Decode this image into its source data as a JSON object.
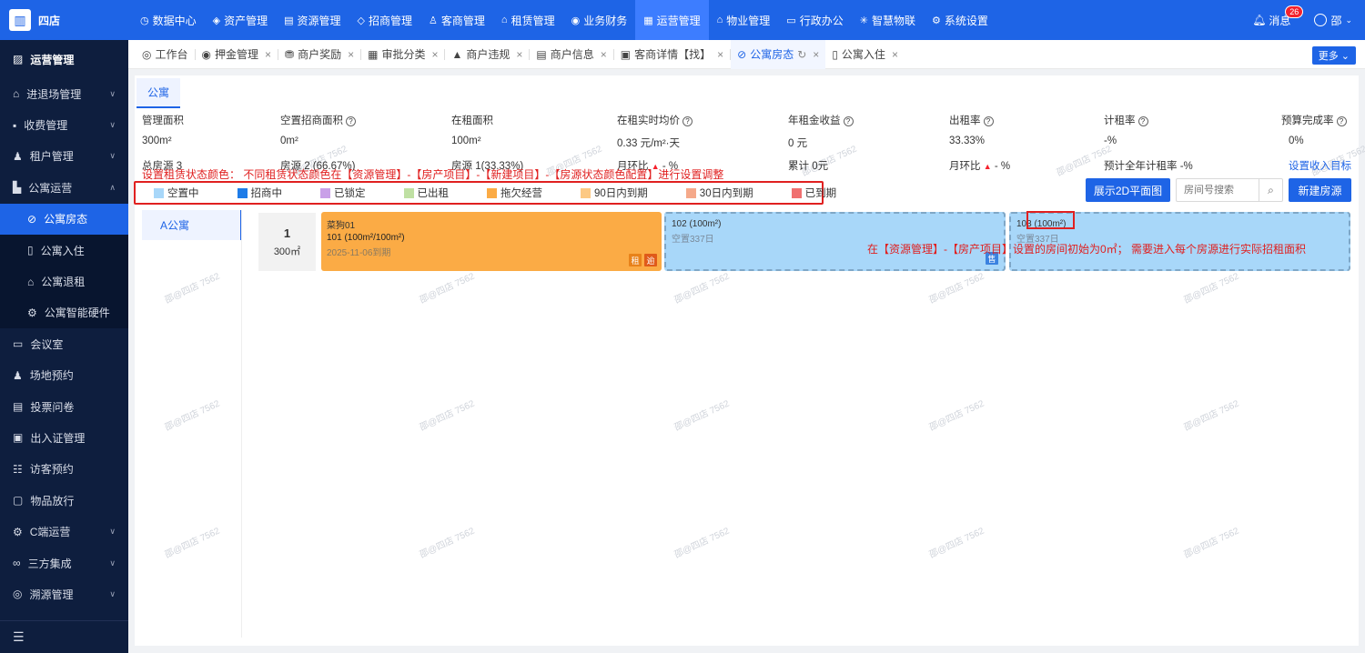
{
  "app": {
    "logo_text": "四店",
    "logo_icon": "building-logo"
  },
  "topnav": [
    {
      "label": "数据中心",
      "icon": "clock-icon"
    },
    {
      "label": "资产管理",
      "icon": "cube-icon"
    },
    {
      "label": "资源管理",
      "icon": "building-icon"
    },
    {
      "label": "招商管理",
      "icon": "tag-icon"
    },
    {
      "label": "客商管理",
      "icon": "users-icon"
    },
    {
      "label": "租赁管理",
      "icon": "house-icon"
    },
    {
      "label": "业务财务",
      "icon": "coin-icon"
    },
    {
      "label": "运营管理",
      "icon": "chart-icon",
      "active": true
    },
    {
      "label": "物业管理",
      "icon": "home-icon"
    },
    {
      "label": "行政办公",
      "icon": "monitor-icon"
    },
    {
      "label": "智慧物联",
      "icon": "iot-icon"
    },
    {
      "label": "系统设置",
      "icon": "gear-icon"
    }
  ],
  "topright": {
    "messages_label": "消息",
    "message_count": "26",
    "user_name": "邵"
  },
  "sidebar": {
    "header": "运营管理",
    "items": [
      {
        "label": "进退场管理",
        "expandable": true
      },
      {
        "label": "收费管理",
        "expandable": true
      },
      {
        "label": "租户管理",
        "expandable": true
      },
      {
        "label": "公寓运营",
        "expandable": true,
        "expanded": true
      },
      {
        "label": "公寓房态",
        "sub": true,
        "active": true
      },
      {
        "label": "公寓入住",
        "sub": true
      },
      {
        "label": "公寓退租",
        "sub": true
      },
      {
        "label": "公寓智能硬件",
        "sub": true
      },
      {
        "label": "会议室"
      },
      {
        "label": "场地预约"
      },
      {
        "label": "投票问卷"
      },
      {
        "label": "出入证管理"
      },
      {
        "label": "访客预约"
      },
      {
        "label": "物品放行"
      },
      {
        "label": "C端运营",
        "expandable": true
      },
      {
        "label": "三方集成",
        "expandable": true
      },
      {
        "label": "溯源管理",
        "expandable": true
      }
    ],
    "footer_icon": "menu-fold-icon"
  },
  "tabs": [
    {
      "label": "工作台",
      "closable": false
    },
    {
      "label": "押金管理",
      "closable": true
    },
    {
      "label": "商户奖励",
      "closable": true
    },
    {
      "label": "审批分类",
      "closable": true
    },
    {
      "label": "商户违规",
      "closable": true
    },
    {
      "label": "商户信息",
      "closable": true
    },
    {
      "label": "客商详情【找】",
      "closable": true
    },
    {
      "label": "公寓房态",
      "closable": true,
      "active": true
    },
    {
      "label": "公寓入住",
      "closable": true
    }
  ],
  "more_label": "更多",
  "subtab": "公寓",
  "stats": {
    "headers": [
      "管理面积",
      "空置招商面积",
      "在租面积",
      "在租实时均价",
      "年租金收益",
      "出租率",
      "计租率",
      "预算完成率"
    ],
    "values": [
      "300m²",
      "0m²",
      "100m²",
      "0.33 元/m²·天",
      "0 元",
      "33.33%",
      "-%",
      "0%"
    ],
    "row3": [
      "总房源 3",
      "房源 2 (66.67%)",
      "房源 1(33.33%)",
      "月环比",
      "累计 0元",
      "月环比",
      "预计全年计租率 -%",
      "设置收入目标"
    ],
    "mom_suffix": "- %"
  },
  "notes": {
    "legend_note": "设置租赁状态颜色： 不同租赁状态颜色在【资源管理】-【房产项目】-【新建项目】-【房源状态颜色配置】进行设置调整",
    "area_note": "在【资源管理】-【房产项目】设置的房间初始为0㎡； 需要进入每个房源进行实际招租面积"
  },
  "legend": [
    {
      "label": "空置中",
      "color": "#a8d7f9"
    },
    {
      "label": "招商中",
      "color": "#1e7ce8"
    },
    {
      "label": "已锁定",
      "color": "#c9a0e8"
    },
    {
      "label": "已出租",
      "color": "#bfe0a3"
    },
    {
      "label": "拖欠经营",
      "color": "#fbab45"
    },
    {
      "label": "90日内到期",
      "color": "#fcc983"
    },
    {
      "label": "30日内到期",
      "color": "#f5a98a"
    },
    {
      "label": "已到期",
      "color": "#f07070"
    }
  ],
  "buttons": {
    "show_2d": "展示2D平面图",
    "new_room": "新建房源"
  },
  "search": {
    "placeholder": "房间号搜索"
  },
  "building": "A公寓",
  "floor": {
    "number": "1",
    "area": "300㎡"
  },
  "rooms": [
    {
      "tenant": "菜狗01",
      "line2": "101 (100m²/100m²)",
      "line3": "2025-11-06到期",
      "tags": [
        "租",
        "逾"
      ]
    },
    {
      "line1": "102 (100m²)",
      "line2": "空置337日",
      "tags": [
        "售"
      ]
    },
    {
      "line1": "103 (100m²)",
      "line2": "空置337日"
    }
  ],
  "watermark": "邵@四店 7562",
  "colors": {
    "primary": "#1e64e6",
    "sidebar": "#0e1e3e",
    "alert": "#e02020"
  }
}
